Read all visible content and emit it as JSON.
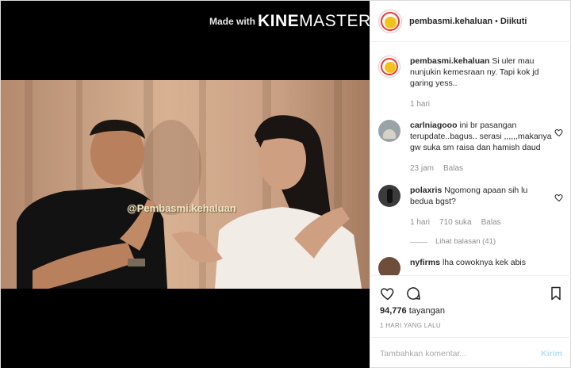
{
  "media": {
    "watermark": {
      "made_with": "Made with",
      "kine": "KINE",
      "master": "MASTER"
    },
    "video_handle": "@Pembasmi.kehaluan"
  },
  "header": {
    "username": "pembasmi.kehaluan",
    "separator": "•",
    "follow_status": "Diikuti",
    "avatar_icon": "brand-avatar-icon"
  },
  "comments": [
    {
      "username": "pembasmi.kehaluan",
      "text": "Si uler mau nunjukin kemesraan ny. Tapi kok jd garing yess..",
      "time": "1 hari"
    },
    {
      "username": "carlniagooo",
      "text": "ini br pasangan terupdate..bagus.. serasi ,,,,,,makanya gw suka sm raisa dan hamish daud",
      "time": "23 jam",
      "reply": "Balas"
    },
    {
      "username": "polaxris",
      "text": "Ngomong apaan sih lu bedua bgst?",
      "time": "1 hari",
      "likes": "710 suka",
      "reply": "Balas",
      "view_replies": "Lihat balasan (41)"
    },
    {
      "username": "nyfirms",
      "text": "lha cowoknya kek abis"
    }
  ],
  "actions": {
    "views_count": "94,776",
    "views_label": "tayangan",
    "date": "1 HARI YANG LALU",
    "comment_placeholder": "Tambahkan komentar...",
    "send_label": "Kirim"
  },
  "colors": {
    "link_disabled": "#b2dffc",
    "muted": "#8e8e8e",
    "text": "#262626"
  }
}
